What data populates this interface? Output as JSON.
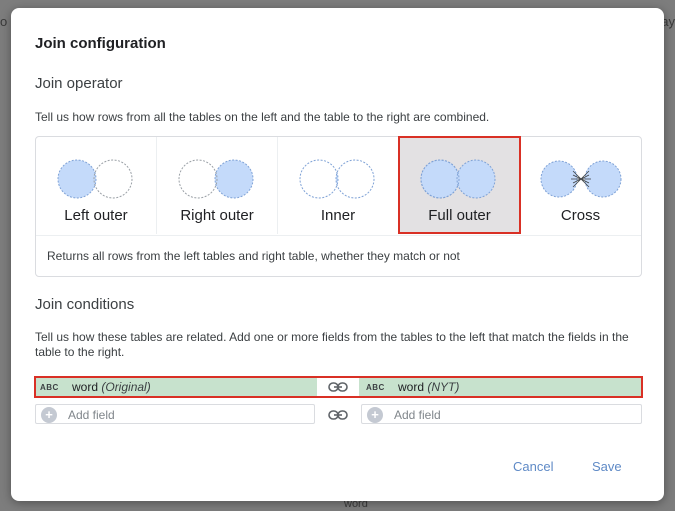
{
  "background": {
    "left_fragment": "o",
    "right_fragment": "ay",
    "bottom_fragment": "word"
  },
  "dialog": {
    "title": "Join configuration",
    "operator_section": {
      "heading": "Join operator",
      "help": "Tell us how rows from all the tables on the left and the table to the right are combined.",
      "options": [
        {
          "label": "Left outer",
          "icon": "left-outer-venn-icon",
          "selected": false
        },
        {
          "label": "Right outer",
          "icon": "right-outer-venn-icon",
          "selected": false
        },
        {
          "label": "Inner",
          "icon": "inner-venn-icon",
          "selected": false
        },
        {
          "label": "Full outer",
          "icon": "full-outer-venn-icon",
          "selected": true
        },
        {
          "label": "Cross",
          "icon": "cross-join-icon",
          "selected": false
        }
      ],
      "description": "Returns all rows from the left tables and right table, whether they match or not"
    },
    "conditions_section": {
      "heading": "Join conditions",
      "help": "Tell us how these tables are related. Add one or more fields from the tables to the left that match the fields in the table to the right.",
      "rows": [
        {
          "left": {
            "type_badge": "ABC",
            "name": "word",
            "source": "(Original)"
          },
          "right": {
            "type_badge": "ABC",
            "name": "word",
            "source": "(NYT)"
          },
          "link_icon": "link-icon"
        },
        {
          "left": {
            "placeholder": "Add field"
          },
          "right": {
            "placeholder": "Add field"
          },
          "link_icon": "link-icon"
        }
      ]
    },
    "buttons": {
      "cancel": "Cancel",
      "save": "Save"
    }
  },
  "colors": {
    "accent_selected_border": "#d93025",
    "venn_fill": "#c4dafa",
    "condition_highlight": "#c7e2cd",
    "button_text": "#5f8ac6"
  }
}
